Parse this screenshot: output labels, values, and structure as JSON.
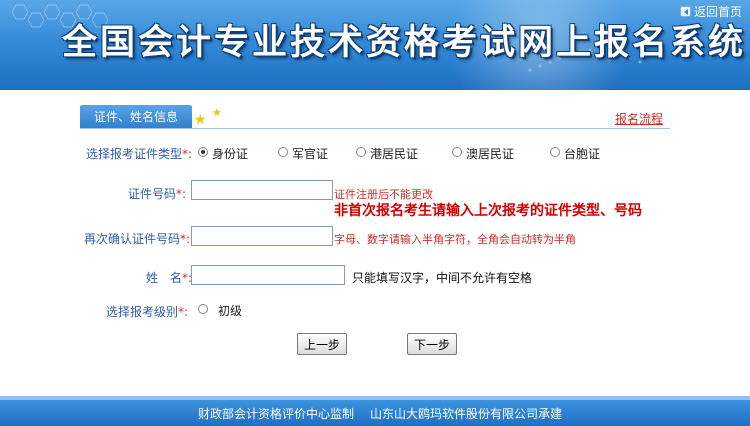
{
  "header": {
    "title": "全国会计专业技术资格考试网上报名系统",
    "home_link": "返回首页",
    "home_icon": "back-icon"
  },
  "tab": {
    "label": "证件、姓名信息",
    "flow_link": "报名流程"
  },
  "form": {
    "id_type": {
      "label": "选择报考证件类型",
      "required_mark": "*:",
      "options": [
        "身份证",
        "军官证",
        "港居民证",
        "澳居民证",
        "台胞证"
      ],
      "selected": "身份证"
    },
    "id_number": {
      "label": "证件号码",
      "required_mark": "*:",
      "value": "",
      "hint_red": "证件注册后不能更改",
      "hint_big": "非首次报名考生请输入上次报考的证件类型、号码"
    },
    "id_confirm": {
      "label": "再次确认证件号码",
      "required_mark": "*:",
      "value": "",
      "hint_red": "字母、数字请输入半角字符，全角会自动转为半角"
    },
    "name": {
      "label": "姓　名",
      "required_mark": "*:",
      "value": "",
      "hint": "只能填写汉字，中间不允许有空格"
    },
    "level": {
      "label": "选择报考级别",
      "required_mark": "*:",
      "options": [
        "初级"
      ]
    }
  },
  "buttons": {
    "prev": "上一步",
    "next": "下一步"
  },
  "footer": {
    "left": "财政部会计资格评价中心监制",
    "right": "山东山大鸥玛软件股份有限公司承建"
  },
  "colors": {
    "header_blue": "#2f86d6",
    "label_blue": "#2f5ea8",
    "warning_red": "#d02b2b"
  }
}
